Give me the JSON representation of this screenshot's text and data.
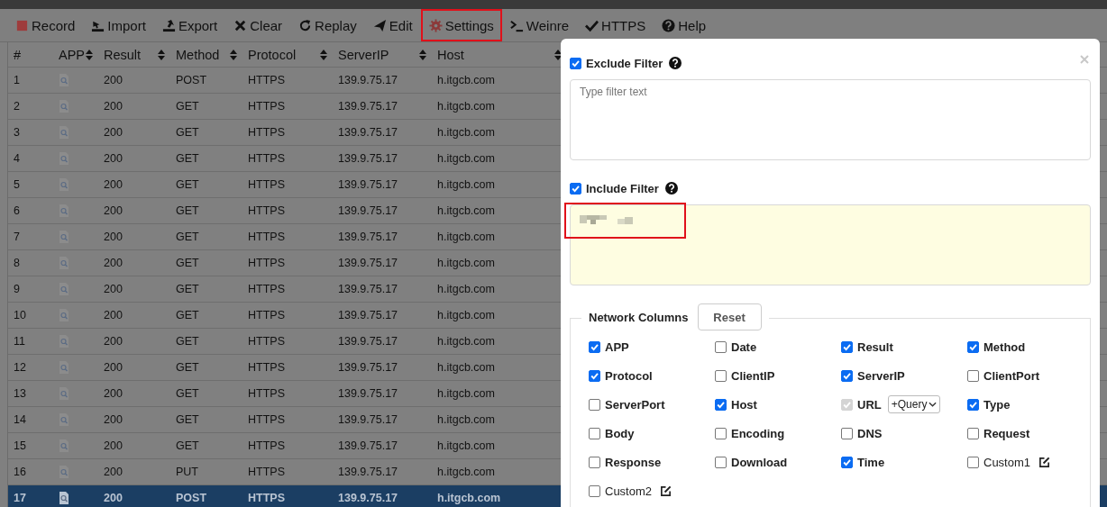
{
  "toolbar": [
    {
      "kind": "record",
      "label": "Record",
      "highlighted": false
    },
    {
      "kind": "import",
      "label": "Import",
      "highlighted": false
    },
    {
      "kind": "export",
      "label": "Export",
      "highlighted": false
    },
    {
      "kind": "clear",
      "label": "Clear",
      "highlighted": false
    },
    {
      "kind": "replay",
      "label": "Replay",
      "highlighted": false
    },
    {
      "kind": "edit",
      "label": "Edit",
      "highlighted": false
    },
    {
      "kind": "settings",
      "label": "Settings",
      "highlighted": true
    },
    {
      "kind": "weinre",
      "label": "Weinre",
      "highlighted": false
    },
    {
      "kind": "https",
      "label": "HTTPS",
      "highlighted": false
    },
    {
      "kind": "help",
      "label": "Help",
      "highlighted": false
    }
  ],
  "table": {
    "columns": [
      {
        "label": "#",
        "sortable": false
      },
      {
        "label": "APP",
        "sortable": true
      },
      {
        "label": "Result",
        "sortable": true
      },
      {
        "label": "Method",
        "sortable": true
      },
      {
        "label": "Protocol",
        "sortable": true
      },
      {
        "label": "ServerIP",
        "sortable": true
      },
      {
        "label": "Host",
        "sortable": true
      }
    ],
    "rows": [
      {
        "number": "1",
        "result": "200",
        "method": "POST",
        "protocol": "HTTPS",
        "server_ip": "139.9.75.17",
        "host": "h.itgcb.com",
        "selected": false
      },
      {
        "number": "2",
        "result": "200",
        "method": "GET",
        "protocol": "HTTPS",
        "server_ip": "139.9.75.17",
        "host": "h.itgcb.com",
        "selected": false
      },
      {
        "number": "3",
        "result": "200",
        "method": "GET",
        "protocol": "HTTPS",
        "server_ip": "139.9.75.17",
        "host": "h.itgcb.com",
        "selected": false
      },
      {
        "number": "4",
        "result": "200",
        "method": "GET",
        "protocol": "HTTPS",
        "server_ip": "139.9.75.17",
        "host": "h.itgcb.com",
        "selected": false
      },
      {
        "number": "5",
        "result": "200",
        "method": "GET",
        "protocol": "HTTPS",
        "server_ip": "139.9.75.17",
        "host": "h.itgcb.com",
        "selected": false
      },
      {
        "number": "6",
        "result": "200",
        "method": "GET",
        "protocol": "HTTPS",
        "server_ip": "139.9.75.17",
        "host": "h.itgcb.com",
        "selected": false
      },
      {
        "number": "7",
        "result": "200",
        "method": "GET",
        "protocol": "HTTPS",
        "server_ip": "139.9.75.17",
        "host": "h.itgcb.com",
        "selected": false
      },
      {
        "number": "8",
        "result": "200",
        "method": "GET",
        "protocol": "HTTPS",
        "server_ip": "139.9.75.17",
        "host": "h.itgcb.com",
        "selected": false
      },
      {
        "number": "9",
        "result": "200",
        "method": "GET",
        "protocol": "HTTPS",
        "server_ip": "139.9.75.17",
        "host": "h.itgcb.com",
        "selected": false
      },
      {
        "number": "10",
        "result": "200",
        "method": "GET",
        "protocol": "HTTPS",
        "server_ip": "139.9.75.17",
        "host": "h.itgcb.com",
        "selected": false
      },
      {
        "number": "11",
        "result": "200",
        "method": "GET",
        "protocol": "HTTPS",
        "server_ip": "139.9.75.17",
        "host": "h.itgcb.com",
        "selected": false
      },
      {
        "number": "12",
        "result": "200",
        "method": "GET",
        "protocol": "HTTPS",
        "server_ip": "139.9.75.17",
        "host": "h.itgcb.com",
        "selected": false
      },
      {
        "number": "13",
        "result": "200",
        "method": "GET",
        "protocol": "HTTPS",
        "server_ip": "139.9.75.17",
        "host": "h.itgcb.com",
        "selected": false
      },
      {
        "number": "14",
        "result": "200",
        "method": "GET",
        "protocol": "HTTPS",
        "server_ip": "139.9.75.17",
        "host": "h.itgcb.com",
        "selected": false
      },
      {
        "number": "15",
        "result": "200",
        "method": "GET",
        "protocol": "HTTPS",
        "server_ip": "139.9.75.17",
        "host": "h.itgcb.com",
        "selected": false
      },
      {
        "number": "16",
        "result": "200",
        "method": "PUT",
        "protocol": "HTTPS",
        "server_ip": "139.9.75.17",
        "host": "h.itgcb.com",
        "selected": false
      },
      {
        "number": "17",
        "result": "200",
        "method": "POST",
        "protocol": "HTTPS",
        "server_ip": "139.9.75.17",
        "host": "h.itgcb.com",
        "selected": true
      }
    ]
  },
  "dialog": {
    "exclude_filter": {
      "label": "Exclude Filter",
      "checked": true,
      "placeholder": "Type filter text"
    },
    "include_filter": {
      "label": "Include Filter",
      "checked": true,
      "highlighted": true
    },
    "network_columns": {
      "title": "Network Columns",
      "reset": "Reset",
      "items": [
        {
          "kind": "check",
          "label": "APP",
          "checked": true,
          "disabled": false
        },
        {
          "kind": "check",
          "label": "Date",
          "checked": false,
          "disabled": false
        },
        {
          "kind": "check",
          "label": "Result",
          "checked": true,
          "disabled": false
        },
        {
          "kind": "check",
          "label": "Method",
          "checked": true,
          "disabled": false
        },
        {
          "kind": "check",
          "label": "Protocol",
          "checked": true,
          "disabled": false
        },
        {
          "kind": "check",
          "label": "ClientIP",
          "checked": false,
          "disabled": false
        },
        {
          "kind": "check",
          "label": "ServerIP",
          "checked": true,
          "disabled": false
        },
        {
          "kind": "check",
          "label": "ClientPort",
          "checked": false,
          "disabled": false
        },
        {
          "kind": "check",
          "label": "ServerPort",
          "checked": false,
          "disabled": false
        },
        {
          "kind": "check",
          "label": "Host",
          "checked": true,
          "disabled": false
        },
        {
          "kind": "select",
          "label": "URL",
          "checked": true,
          "disabled": true,
          "option": "+Query"
        },
        {
          "kind": "check",
          "label": "Type",
          "checked": true,
          "disabled": false
        },
        {
          "kind": "check",
          "label": "Body",
          "checked": false,
          "disabled": false
        },
        {
          "kind": "check",
          "label": "Encoding",
          "checked": false,
          "disabled": false
        },
        {
          "kind": "check",
          "label": "DNS",
          "checked": false,
          "disabled": false
        },
        {
          "kind": "check",
          "label": "Request",
          "checked": false,
          "disabled": false
        },
        {
          "kind": "check",
          "label": "Response",
          "checked": false,
          "disabled": false
        },
        {
          "kind": "check",
          "label": "Download",
          "checked": false,
          "disabled": false
        },
        {
          "kind": "check",
          "label": "Time",
          "checked": true,
          "disabled": false
        },
        {
          "kind": "custom",
          "label": "Custom1",
          "checked": false,
          "disabled": false
        },
        {
          "kind": "custom",
          "label": "Custom2",
          "checked": false,
          "disabled": false
        }
      ]
    }
  }
}
